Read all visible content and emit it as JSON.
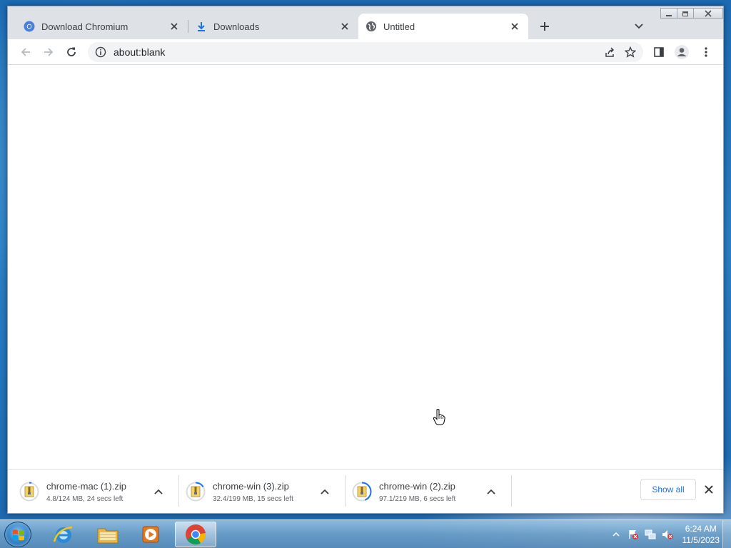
{
  "browser": {
    "tabs": [
      {
        "title": "Download Chromium",
        "icon": "chromium-favicon-icon",
        "active": false
      },
      {
        "title": "Downloads",
        "icon": "download-arrow-icon",
        "active": false
      },
      {
        "title": "Untitled",
        "icon": "globe-icon",
        "active": true
      }
    ],
    "omnibox": {
      "url": "about:blank"
    }
  },
  "downloads": {
    "items": [
      {
        "name": "chrome-mac (1).zip",
        "status": "4.8/124 MB, 24 secs left",
        "progress": 0.04
      },
      {
        "name": "chrome-win (3).zip",
        "status": "32.4/199 MB, 15 secs left",
        "progress": 0.16
      },
      {
        "name": "chrome-win (2).zip",
        "status": "97.1/219 MB, 6 secs left",
        "progress": 0.44
      }
    ],
    "show_all_label": "Show all"
  },
  "taskbar": {
    "apps": [
      "internet-explorer-icon",
      "file-explorer-icon",
      "media-player-icon",
      "chrome-icon"
    ],
    "clock": {
      "time": "6:24 AM",
      "date": "11/5/2023"
    }
  },
  "colors": {
    "accent": "#1a73e8",
    "tab_strip": "#dee1e6",
    "desktop": "#1f6fb5"
  }
}
